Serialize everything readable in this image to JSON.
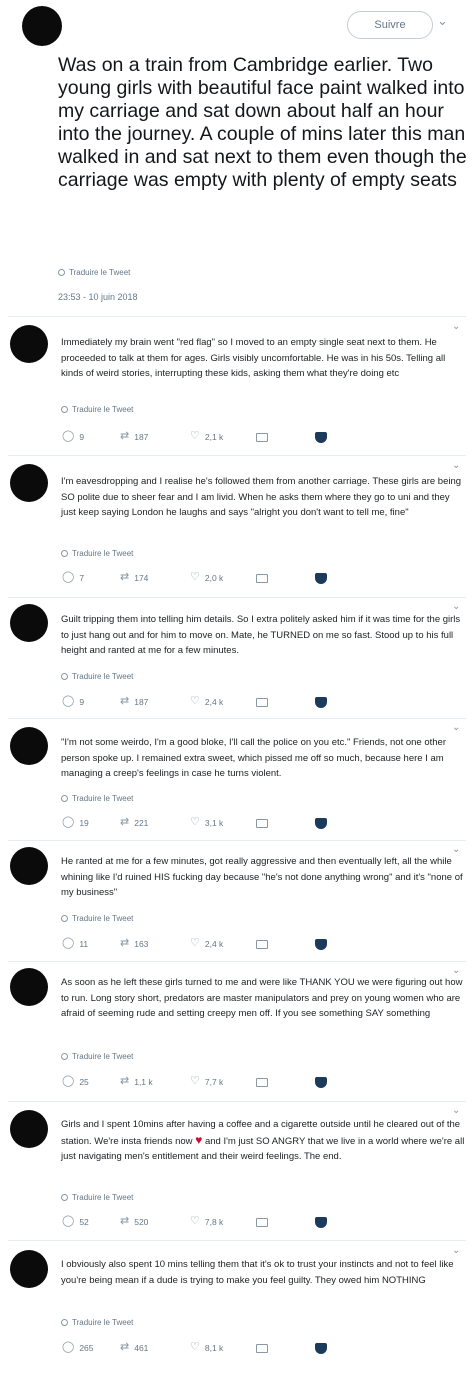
{
  "header": {
    "follow_label": "Suivre"
  },
  "main_tweet": {
    "text": "Was on a train from Cambridge earlier. Two young girls with beautiful face paint walked into my carriage and sat down about half an hour into the journey. A couple of mins later this man walked in and sat next to them even though the carriage was empty with plenty of empty seats",
    "translate_label": "Traduire le Tweet",
    "timestamp": "23:53 - 10 juin 2018"
  },
  "replies": [
    {
      "text": "Immediately my brain went \"red flag\" so I moved to an empty single seat next to them. He proceeded to talk at them for ages. Girls visibly uncomfortable. He was in his 50s. Telling all kinds of weird stories, interrupting these kids, asking them what they're doing etc",
      "translate_label": "Traduire le Tweet",
      "replies": "9",
      "retweets": "187",
      "likes": "2,1 k"
    },
    {
      "text": "I'm eavesdropping and I realise he's followed them from another carriage. These girls are being SO polite due to sheer fear and I am livid. When he asks them where they go to uni and they just keep saying London he laughs and says \"alright you don't want to tell me, fine\"",
      "translate_label": "Traduire le Tweet",
      "replies": "7",
      "retweets": "174",
      "likes": "2,0 k"
    },
    {
      "text": "Guilt tripping them into telling him details. So I extra politely asked him if it was time for the girls to just hang out and for him to move on. Mate, he TURNED on me so fast. Stood up to his full height and ranted at me for a few minutes.",
      "translate_label": "Traduire le Tweet",
      "replies": "9",
      "retweets": "187",
      "likes": "2,4 k"
    },
    {
      "text": "\"I'm not some weirdo, I'm a good bloke, I'll call the police on you etc.\" Friends, not one other person spoke up. I remained extra sweet, which pissed me off so much, because here I am managing a creep's feelings in case he turns violent.",
      "translate_label": "Traduire le Tweet",
      "replies": "19",
      "retweets": "221",
      "likes": "3,1 k"
    },
    {
      "text": "He ranted at me for a few minutes, got really aggressive and then eventually left, all the while whining like I'd ruined HIS fucking day because \"he's not done anything wrong\" and it's \"none of my business\"",
      "translate_label": "Traduire le Tweet",
      "replies": "11",
      "retweets": "163",
      "likes": "2,4 k"
    },
    {
      "text": "As soon as he left these girls turned to me and were like THANK YOU we were figuring out how to run. Long story short, predators are master manipulators and prey on young women who are afraid of seeming rude and setting creepy men off. If you see something SAY something",
      "translate_label": "Traduire le Tweet",
      "replies": "25",
      "retweets": "1,1 k",
      "likes": "7,7 k"
    },
    {
      "text_before": "Girls and I spent 10mins after having a coffee and a cigarette outside until he cleared out of the station. We're insta friends now ",
      "text_after": " and I'm just SO ANGRY that we live in a world where we're all just navigating men's entitlement and their weird feelings. The end.",
      "translate_label": "Traduire le Tweet",
      "replies": "52",
      "retweets": "520",
      "likes": "7,8 k"
    },
    {
      "text": "I obviously also spent 10 mins telling them that it's ok to trust your instincts and not to feel like you're being mean if a dude is trying to make you feel guilty. They owed him NOTHING",
      "translate_label": "Traduire le Tweet",
      "replies": "265",
      "retweets": "461",
      "likes": "8,1 k"
    }
  ],
  "icons": {
    "heart_color": "#c8102e",
    "shield_color": "#1b3a5c"
  }
}
